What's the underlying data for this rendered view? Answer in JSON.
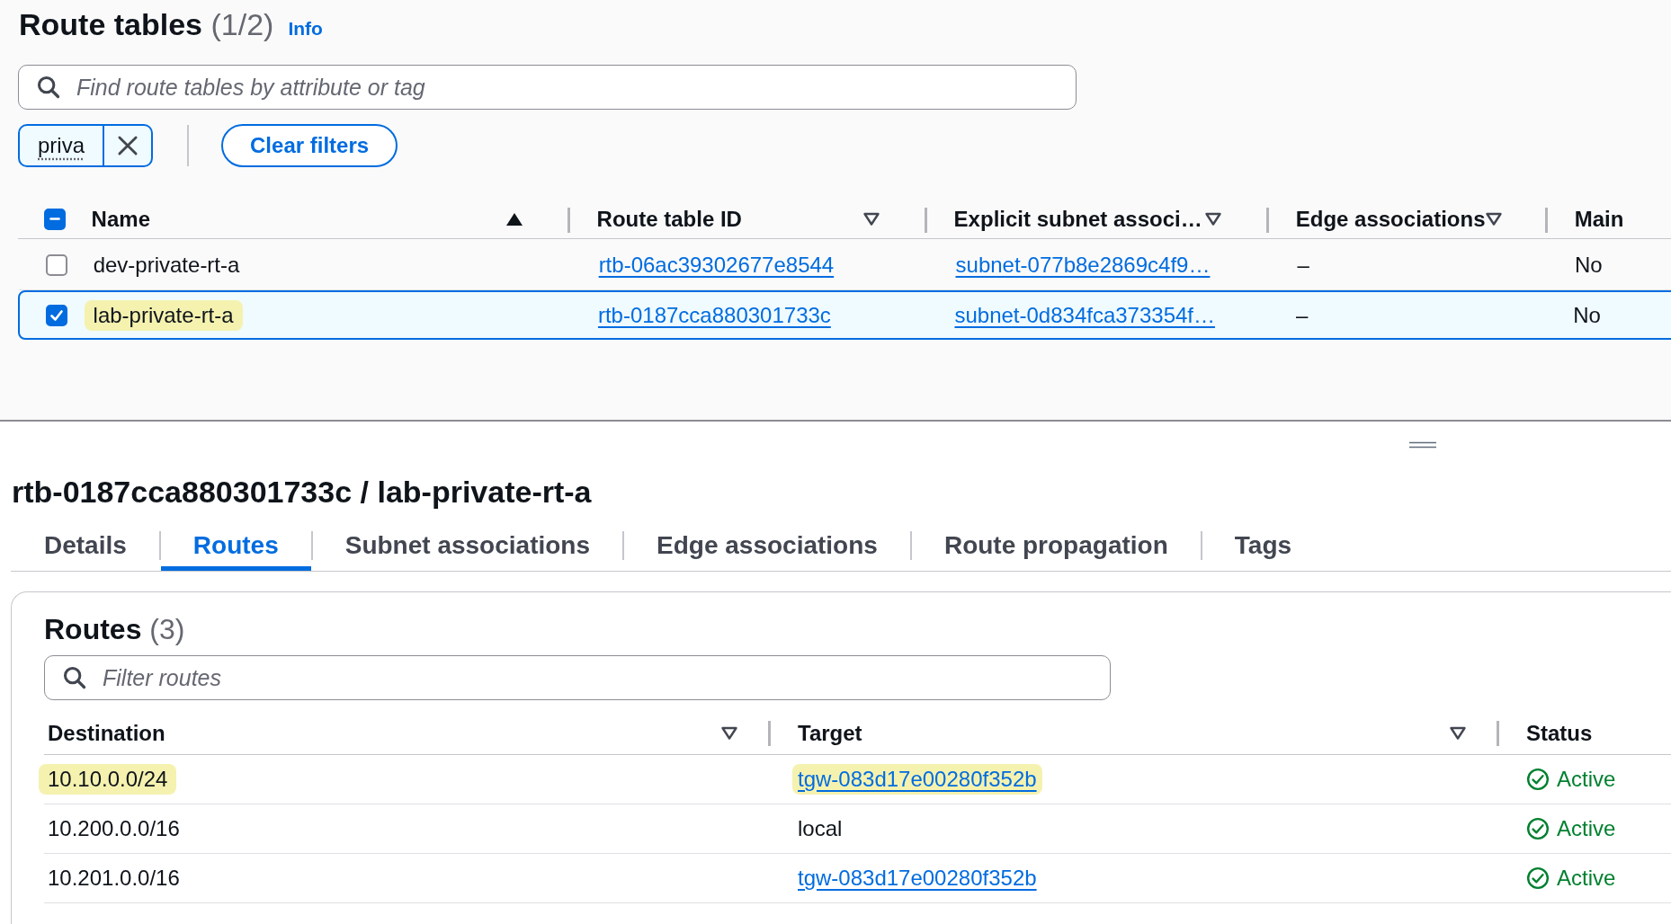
{
  "header": {
    "title": "Route tables",
    "count": "(1/2)",
    "info": "Info"
  },
  "search": {
    "placeholder": "Find route tables by attribute or tag"
  },
  "filter_tokens": [
    {
      "text": "priva"
    }
  ],
  "clear_filters": "Clear filters",
  "table": {
    "select_all": {
      "indeterminate": true
    },
    "columns": [
      {
        "label": "Name",
        "sorted_ascending": true
      },
      {
        "label": "Route table ID",
        "sorted_ascending": false
      },
      {
        "label": "Explicit subnet associ…",
        "sorted_ascending": false
      },
      {
        "label": "Edge associations",
        "sorted_ascending": false
      },
      {
        "label": "Main"
      }
    ],
    "rows": [
      {
        "selected": false,
        "name": "dev-private-rt-a",
        "name_highlighted": false,
        "route_table_id": "rtb-06ac39302677e8544",
        "subnet": "subnet-077b8e2869c4f9…",
        "edge": "–",
        "main": "No"
      },
      {
        "selected": true,
        "name": "lab-private-rt-a",
        "name_highlighted": true,
        "route_table_id": "rtb-0187cca880301733c",
        "subnet": "subnet-0d834fca373354f…",
        "edge": "–",
        "main": "No"
      }
    ]
  },
  "detail": {
    "title": "rtb-0187cca880301733c / lab-private-rt-a",
    "tabs": [
      {
        "label": "Details",
        "selected": false
      },
      {
        "label": "Routes",
        "selected": true
      },
      {
        "label": "Subnet associations",
        "selected": false
      },
      {
        "label": "Edge associations",
        "selected": false
      },
      {
        "label": "Route propagation",
        "selected": false
      },
      {
        "label": "Tags",
        "selected": false
      }
    ],
    "routes": {
      "title": "Routes",
      "count": "(3)",
      "filter_placeholder": "Filter routes",
      "columns": [
        {
          "label": "Destination",
          "sorted_ascending": false
        },
        {
          "label": "Target",
          "sorted_ascending": false
        },
        {
          "label": "Status"
        }
      ],
      "rows": [
        {
          "destination": "10.10.0.0/24",
          "target": "tgw-083d17e00280f352b",
          "target_is_link": true,
          "highlighted": true,
          "status": "Active",
          "success": true
        },
        {
          "destination": "10.200.0.0/16",
          "target": "local",
          "target_is_link": false,
          "highlighted": false,
          "status": "Active",
          "success": true
        },
        {
          "destination": "10.201.0.0/16",
          "target": "tgw-083d17e00280f352b",
          "target_is_link": true,
          "highlighted": false,
          "status": "Active",
          "success": true
        }
      ]
    }
  }
}
